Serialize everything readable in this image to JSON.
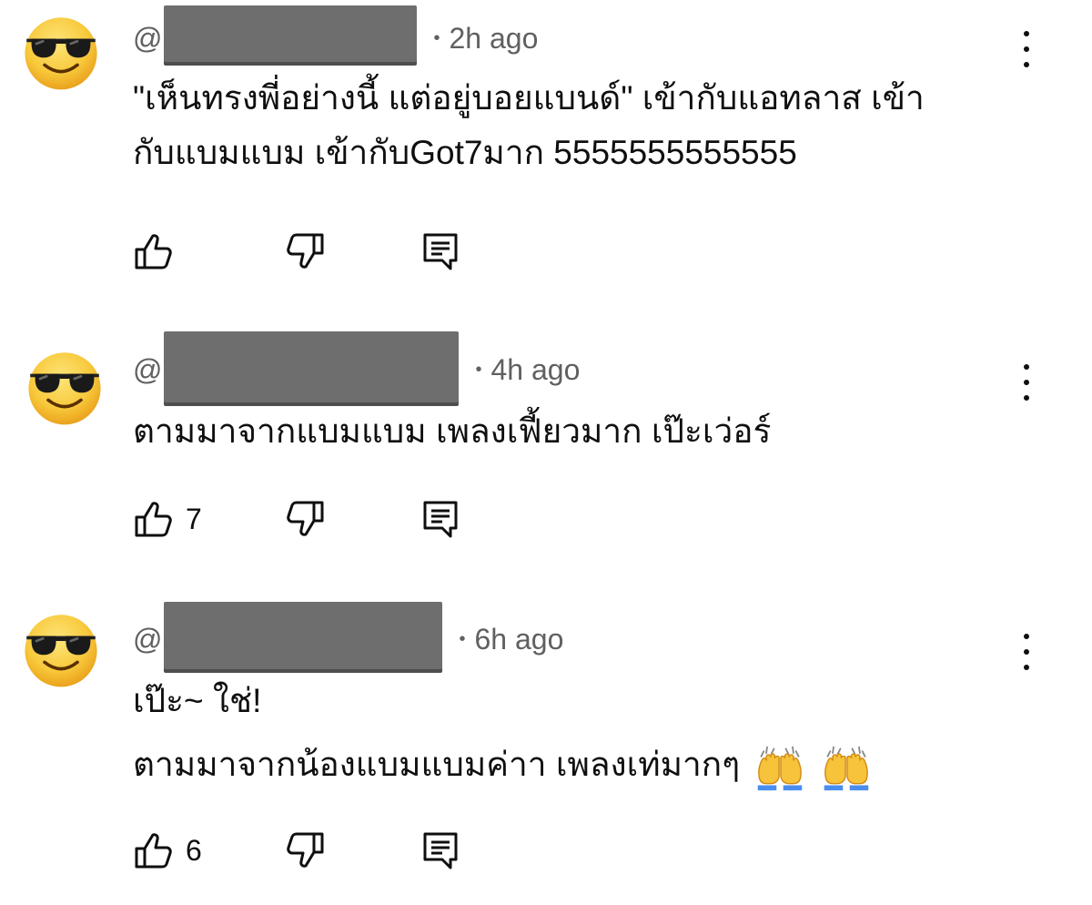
{
  "comments": [
    {
      "handle_prefix": "@",
      "time": "2h ago",
      "lines": [
        "\"เห็นทรงพี่อย่างนี้ แต่อยู่บอยแบนด์\" เข้ากับแอทลาส เข้า",
        "กับแบมแบม เข้ากับGot7มาก 5555555555555"
      ],
      "likes": ""
    },
    {
      "handle_prefix": "@",
      "time": "4h ago",
      "lines": [
        "ตามมาจากแบมแบม เพลงเฟี้ยวมาก เป๊ะเว่อร์"
      ],
      "likes": "7"
    },
    {
      "handle_prefix": "@",
      "time": "6h ago",
      "lines": [
        "เป๊ะ~ ใช่!",
        "ตามมาจากน้องแบมแบมค่าา เพลงเท่มากๆ"
      ],
      "likes": "6",
      "trailing_emoji": "raising-hands-emoji"
    }
  ],
  "icons": {
    "avatar": "sunglasses-face-emoji",
    "like": "thumbs-up-outline-icon",
    "dislike": "thumbs-down-outline-icon",
    "reply": "reply-comment-icon",
    "menu": "more-vert-icon"
  },
  "colors": {
    "text": "#0f0f0f",
    "secondary": "#606060",
    "redaction": "#6e6e6e",
    "emoji_yellow": "#f6c33a"
  }
}
